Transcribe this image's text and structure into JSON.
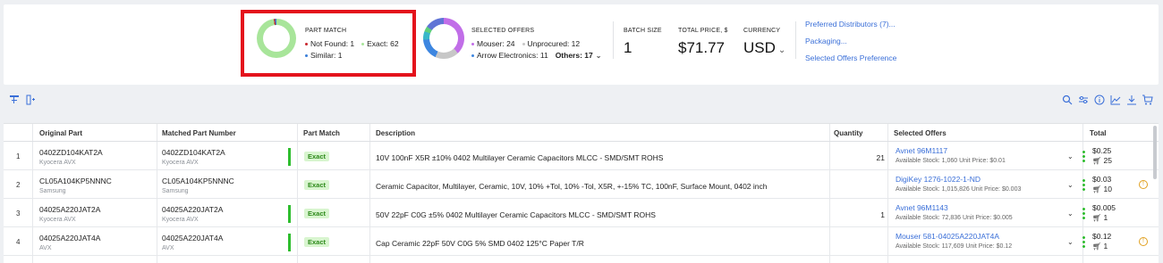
{
  "summary": {
    "part_match": {
      "title": "PART MATCH",
      "not_found": "Not Found: 1",
      "exact": "Exact: 62",
      "similar": "Similar: 1",
      "colors": {
        "not_found": "#c9272e",
        "exact": "#a8e59a",
        "similar": "#3a7fd8"
      }
    },
    "selected_offers": {
      "title": "SELECTED OFFERS",
      "mouser": "Mouser: 24",
      "unprocured": "Unprocured: 12",
      "arrow": "Arrow Electronics: 11",
      "others": "Others: 17",
      "colors": {
        "mouser": "#c16ee8",
        "unprocured": "#c7c7c7",
        "arrow": "#3d86e0"
      }
    },
    "batch_size": {
      "label": "BATCH SIZE",
      "value": "1"
    },
    "total_price": {
      "label": "TOTAL PRICE, $",
      "value": "$71.77"
    },
    "currency": {
      "label": "CURRENCY",
      "value": "USD"
    },
    "links": {
      "preferred": "Preferred Distributors (7)...",
      "packaging": "Packaging...",
      "offers_pref": "Selected Offers Preference"
    }
  },
  "toolbar": {
    "left_icons": [
      "tree-view-icon",
      "add-column-icon"
    ],
    "right_icons": [
      "search-icon",
      "filter-settings-icon",
      "info-icon",
      "chart-icon",
      "download-icon",
      "cart-icon"
    ]
  },
  "table": {
    "headers": {
      "original": "Original Part",
      "matched": "Matched Part Number",
      "part_match": "Part Match",
      "description": "Description",
      "quantity": "Quantity",
      "selected_offers": "Selected Offers",
      "total": "Total"
    },
    "rows": [
      {
        "num": "1",
        "original": "0402ZD104KAT2A",
        "original_mfr": "Kyocera AVX",
        "matched": "0402ZD104KAT2A",
        "matched_mfr": "Kyocera AVX",
        "match": "Exact",
        "description": "10V 100nF X5R ±10% 0402 Multilayer Ceramic Capacitors MLCC - SMD/SMT ROHS",
        "quantity": "21",
        "offer": "Avnet 96M1117",
        "offer_detail": "Available Stock: 1,060   Unit Price: $0.01",
        "total_price": "$0.25",
        "total_qty": "25",
        "warning": false
      },
      {
        "num": "2",
        "original": "CL05A104KP5NNNC",
        "original_mfr": "Samsung",
        "matched": "CL05A104KP5NNNC",
        "matched_mfr": "Samsung",
        "match": "Exact",
        "description": "Ceramic Capacitor, Multilayer, Ceramic, 10V, 10% +Tol, 10% -Tol, X5R, +-15% TC, 100nF, Surface Mount, 0402 inch",
        "quantity": "",
        "offer": "DigiKey 1276-1022-1-ND",
        "offer_detail": "Available Stock: 1,015,826   Unit Price: $0.003",
        "total_price": "$0.03",
        "total_qty": "10",
        "warning": true
      },
      {
        "num": "3",
        "original": "04025A220JAT2A",
        "original_mfr": "Kyocera AVX",
        "matched": "04025A220JAT2A",
        "matched_mfr": "Kyocera AVX",
        "match": "Exact",
        "description": "50V 22pF C0G ±5% 0402 Multilayer Ceramic Capacitors MLCC - SMD/SMT ROHS",
        "quantity": "1",
        "offer": "Avnet 96M1143",
        "offer_detail": "Available Stock: 72,836   Unit Price: $0.005",
        "total_price": "$0.005",
        "total_qty": "1",
        "warning": false
      },
      {
        "num": "4",
        "original": "04025A220JAT4A",
        "original_mfr": "AVX",
        "matched": "04025A220JAT4A",
        "matched_mfr": "AVX",
        "match": "Exact",
        "description": "Cap Ceramic 22pF 50V C0G 5% SMD 0402 125°C Paper T/R",
        "quantity": "",
        "offer": "Mouser 581-04025A220JAT4A",
        "offer_detail": "Available Stock: 117,609   Unit Price: $0.12",
        "total_price": "$0.12",
        "total_qty": "1",
        "warning": true
      }
    ]
  }
}
